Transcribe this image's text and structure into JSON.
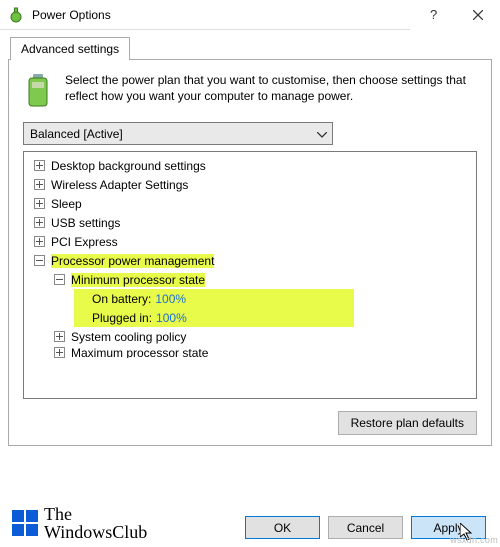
{
  "window": {
    "title": "Power Options"
  },
  "tab": {
    "label": "Advanced settings"
  },
  "intro": {
    "text": "Select the power plan that you want to customise, then choose settings that reflect how you want your computer to manage power."
  },
  "plan_dropdown": {
    "selected": "Balanced [Active]"
  },
  "tree": {
    "items": [
      {
        "label": "Desktop background settings"
      },
      {
        "label": "Wireless Adapter Settings"
      },
      {
        "label": "Sleep"
      },
      {
        "label": "USB settings"
      },
      {
        "label": "PCI Express"
      },
      {
        "label": "Processor power management"
      },
      {
        "label": "System cooling policy"
      },
      {
        "label": "Maximum processor state"
      }
    ],
    "min_proc": {
      "label": "Minimum processor state",
      "on_battery_label": "On battery:",
      "on_battery_value": "100%",
      "plugged_in_label": "Plugged in:",
      "plugged_in_value": "100%"
    }
  },
  "buttons": {
    "restore": "Restore plan defaults",
    "ok": "OK",
    "cancel": "Cancel",
    "apply": "Apply"
  },
  "brand": {
    "line1": "The",
    "line2": "WindowsClub"
  },
  "watermark": "wsxdn.com"
}
